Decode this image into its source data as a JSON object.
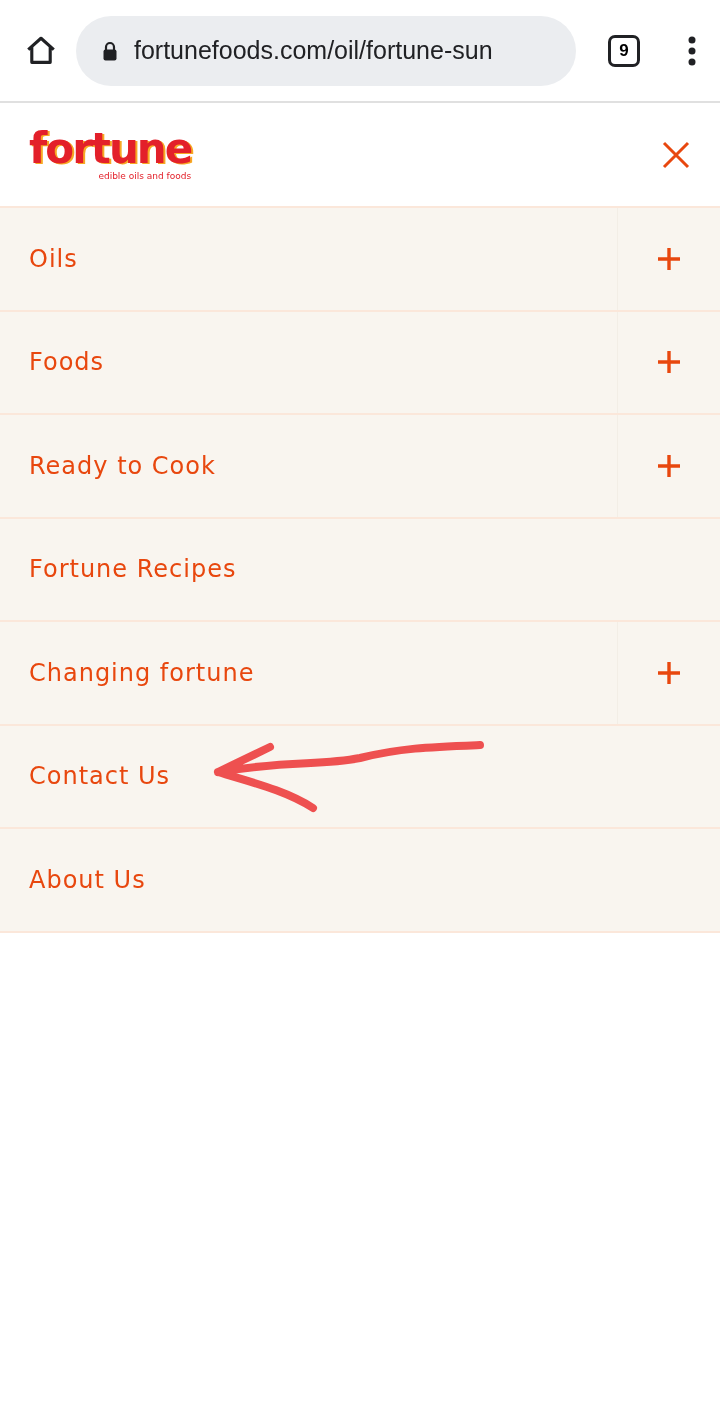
{
  "browser": {
    "url": "fortunefoods.com/oil/fortune-sun",
    "tab_count": "9"
  },
  "header": {
    "logo": {
      "name": "fortune",
      "tagline": "edible oils and foods"
    }
  },
  "menu": [
    {
      "label": "Oils",
      "expandable": true
    },
    {
      "label": "Foods",
      "expandable": true
    },
    {
      "label": "Ready to Cook",
      "expandable": true
    },
    {
      "label": "Fortune Recipes",
      "expandable": false
    },
    {
      "label": "Changing fortune",
      "expandable": true
    },
    {
      "label": "Contact Us",
      "expandable": false
    },
    {
      "label": "About Us",
      "expandable": false
    }
  ]
}
